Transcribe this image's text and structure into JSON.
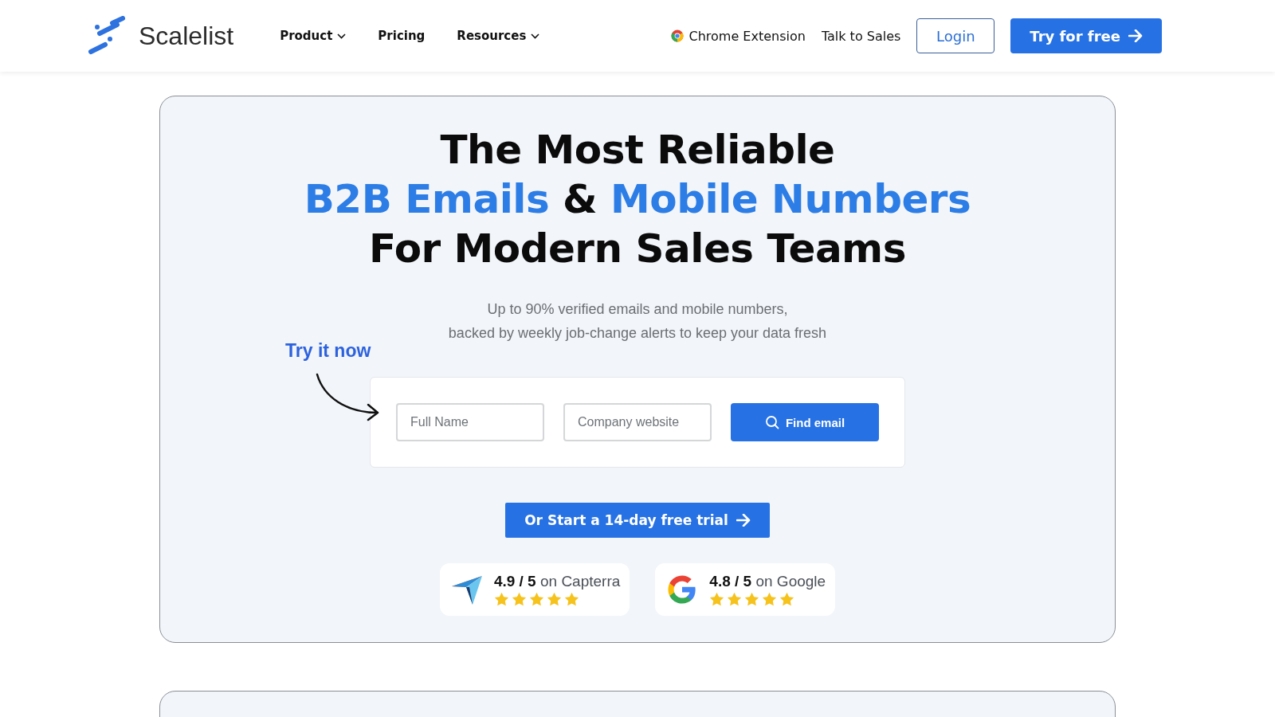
{
  "nav": {
    "brand": "Scalelist",
    "links": [
      {
        "label": "Product",
        "dropdown": true
      },
      {
        "label": "Pricing",
        "dropdown": false
      },
      {
        "label": "Resources",
        "dropdown": true
      }
    ],
    "chrome_extension": "Chrome Extension",
    "talk_to_sales": "Talk to Sales",
    "login": "Login",
    "try_free": "Try for free"
  },
  "hero": {
    "heading_lines": [
      [
        {
          "text": "The Most Reliable",
          "accent": false
        }
      ],
      [
        {
          "text": "B2B Emails",
          "accent": true
        },
        {
          "text": " & ",
          "accent": false
        },
        {
          "text": "Mobile Numbers",
          "accent": true
        }
      ],
      [
        {
          "text": "For Modern Sales Teams",
          "accent": false
        }
      ]
    ],
    "subtitle_lines": [
      "Up to 90% verified emails and mobile numbers,",
      "backed by weekly job-change alerts to keep your data fresh"
    ],
    "try_it_now": "Try it now",
    "form": {
      "name_placeholder": "Full Name",
      "website_placeholder": "Company website",
      "submit": "Find email"
    },
    "trial_button": "Or Start a 14-day free trial",
    "ratings": [
      {
        "kind": "capterra",
        "text": "**4.9 / 5** on Capterra",
        "stars": 5
      },
      {
        "kind": "google",
        "text": "**4.8 / 5** on Google",
        "stars": 5
      }
    ]
  }
}
